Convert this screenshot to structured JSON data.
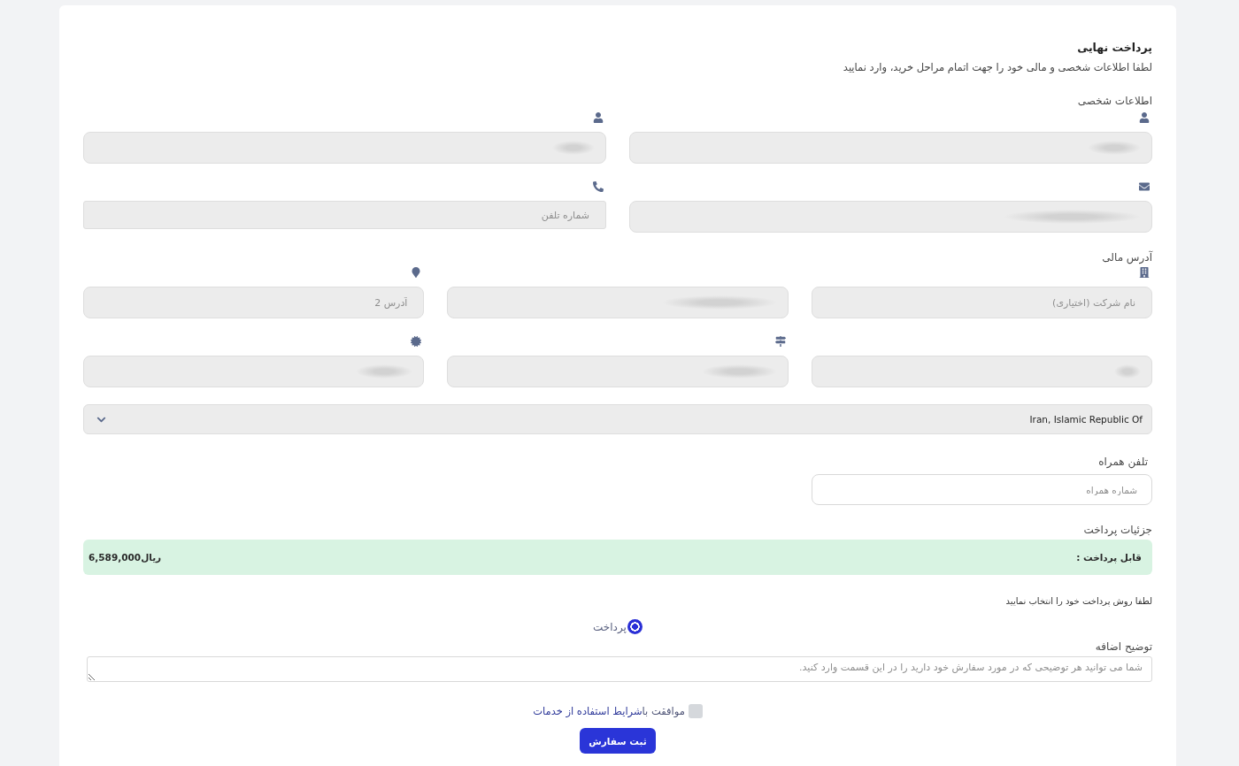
{
  "header": {
    "title": "پرداخت نهایی",
    "subtitle": "لطفا اطلاعات شخصی و مالی خود را جهت اتمام مراحل خرید، وارد نمایید"
  },
  "personal_info": {
    "heading": "اطلاعات شخصی",
    "fields": [
      {
        "blurred": true
      },
      {
        "blurred": true
      },
      {
        "blurred": true
      },
      {
        "placeholder": "شماره تلفن",
        "blurred": false
      }
    ]
  },
  "billing_address": {
    "heading": "آدرس مالی",
    "fields": [
      {
        "placeholder": "نام شرکت (اختیاری)",
        "blurred": false
      },
      {
        "blurred": true
      },
      {
        "placeholder": "آدرس 2",
        "blurred": false
      },
      {
        "blurred": true
      },
      {
        "blurred": true
      },
      {
        "blurred": true
      }
    ],
    "country": {
      "value": "Iran, Islamic Republic Of"
    }
  },
  "mobile": {
    "label": "تلفن همراه",
    "placeholder": "شماره همراه"
  },
  "payment_details": {
    "heading": "جزئیات پرداخت",
    "amount_label": "قابل پرداخت :",
    "amount": "6,589,000ریال"
  },
  "payment_method": {
    "prompt": "لطفا روش پرداخت خود را انتخاب نمایید",
    "options": [
      {
        "label": "پرداخت",
        "selected": true
      }
    ]
  },
  "notes": {
    "label": "توضیح اضافه",
    "placeholder": "شما می توانید هر توضیحی که در مورد سفارش خود دارید را در این قسمت وارد کنید."
  },
  "agreement": {
    "text": "موافقت با",
    "link": "شرایط استفاده از خدمات",
    "checked": false
  },
  "submit_button": "ثبت سفارش"
}
